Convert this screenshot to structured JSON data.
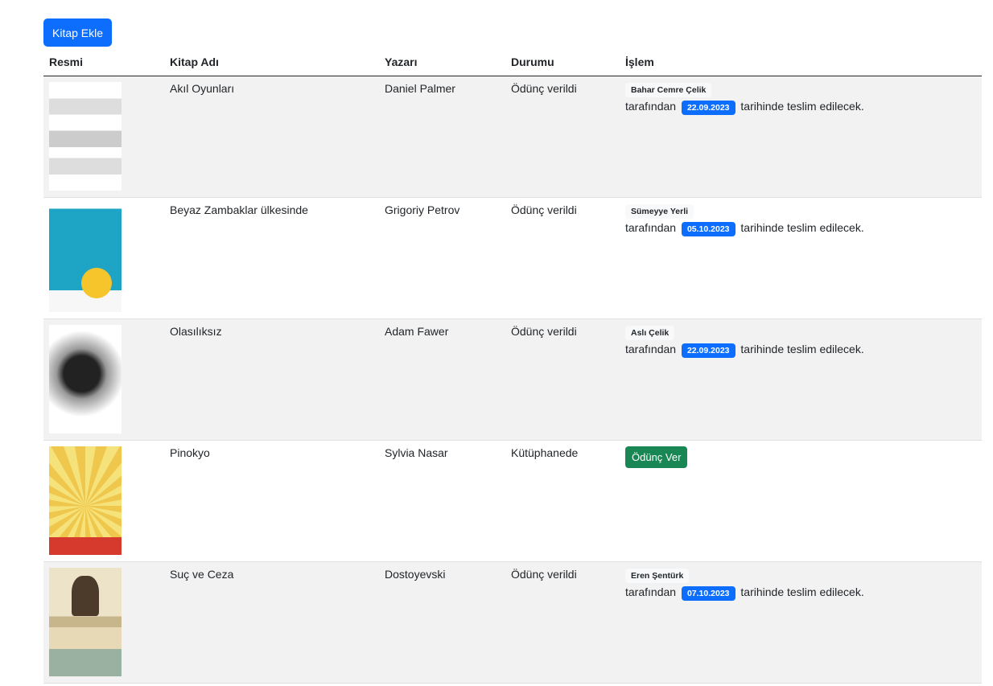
{
  "toolbar": {
    "add_label": "Kitap Ekle"
  },
  "table": {
    "headers": [
      "Resmi",
      "Kitap Adı",
      "Yazarı",
      "Durumu",
      "İşlem"
    ],
    "text_by": "tarafından",
    "text_due": "tarihinde teslim edilecek.",
    "lend_label": "Ödünç Ver",
    "rows": [
      {
        "title": "Akıl Oyunları",
        "author": "Daniel Palmer",
        "status": "Ödünç verildi",
        "borrower": "Bahar Cemre Çelik",
        "due": "22.09.2023"
      },
      {
        "title": "Beyaz Zambaklar ülkesinde",
        "author": "Grigoriy Petrov",
        "status": "Ödünç verildi",
        "borrower": "Sümeyye Yerli",
        "due": "05.10.2023"
      },
      {
        "title": "Olasılıksız",
        "author": "Adam Fawer",
        "status": "Ödünç verildi",
        "borrower": "Aslı Çelik",
        "due": "22.09.2023"
      },
      {
        "title": "Pinokyo",
        "author": "Sylvia Nasar",
        "status": "Kütüphanede"
      },
      {
        "title": "Suç ve Ceza",
        "author": "Dostoyevski",
        "status": "Ödünç verildi",
        "borrower": "Eren Şentürk",
        "due": "07.10.2023"
      }
    ]
  }
}
